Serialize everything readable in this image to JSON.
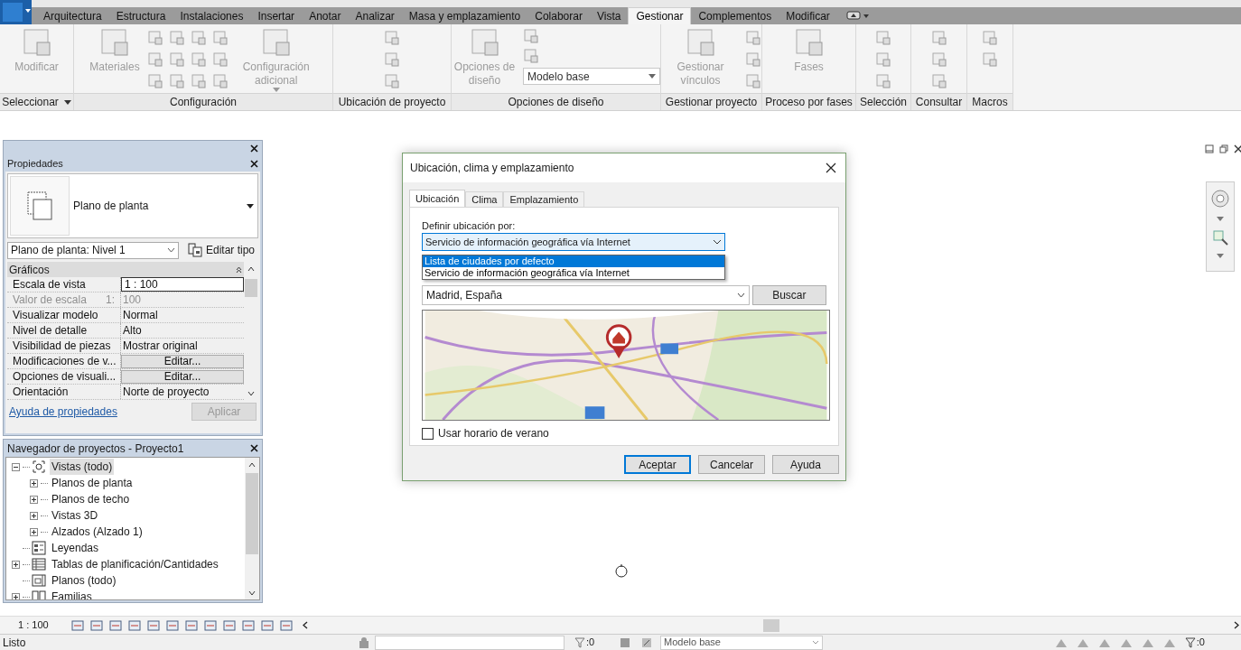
{
  "ribbon_tabs": [
    {
      "label": "Arquitectura",
      "selected": false
    },
    {
      "label": "Estructura",
      "selected": false
    },
    {
      "label": "Instalaciones",
      "selected": false
    },
    {
      "label": "Insertar",
      "selected": false
    },
    {
      "label": "Anotar",
      "selected": false
    },
    {
      "label": "Analizar",
      "selected": false
    },
    {
      "label": "Masa y emplazamiento",
      "selected": false
    },
    {
      "label": "Colaborar",
      "selected": false
    },
    {
      "label": "Vista",
      "selected": false
    },
    {
      "label": "Gestionar",
      "selected": true
    },
    {
      "label": "Complementos",
      "selected": false
    },
    {
      "label": "Modificar",
      "selected": false
    }
  ],
  "ribbon_panels": [
    {
      "title": "Seleccionar",
      "menu": true,
      "buttons": [
        {
          "label": "Modificar"
        }
      ]
    },
    {
      "title": "Configuración",
      "buttons": [
        {
          "label": "Materiales"
        },
        {
          "label": "Configuración adicional"
        }
      ]
    },
    {
      "title": "Ubicación de proyecto"
    },
    {
      "title": "Opciones de diseño",
      "buttons": [
        {
          "label": "Opciones de diseño"
        }
      ],
      "dropdown": "Modelo base"
    },
    {
      "title": "Gestionar proyecto",
      "buttons": [
        {
          "label": "Gestionar vínculos"
        }
      ]
    },
    {
      "title": "Proceso por fases",
      "buttons": [
        {
          "label": "Fases"
        }
      ]
    },
    {
      "title": "Selección"
    },
    {
      "title": "Consultar"
    },
    {
      "title": "Macros"
    }
  ],
  "properties": {
    "title": "Propiedades",
    "type_name": "Plano de planta",
    "instance": "Plano de planta: Nivel 1",
    "edit_type": "Editar tipo",
    "group": "Gráficos",
    "rows": [
      {
        "label": "Escala de vista",
        "value": "1 : 100",
        "kind": "field",
        "disabled": false
      },
      {
        "label": "Valor de escala",
        "unit": "1:",
        "value": "100",
        "kind": "text",
        "disabled": true
      },
      {
        "label": "Visualizar modelo",
        "value": "Normal",
        "kind": "text",
        "disabled": false
      },
      {
        "label": "Nivel de detalle",
        "value": "Alto",
        "kind": "text",
        "disabled": false
      },
      {
        "label": "Visibilidad de piezas",
        "value": "Mostrar original",
        "kind": "text",
        "disabled": false
      },
      {
        "label": "Modificaciones de v...",
        "value": "Editar...",
        "kind": "button",
        "disabled": false
      },
      {
        "label": "Opciones de visuali...",
        "value": "Editar...",
        "kind": "button",
        "disabled": false
      },
      {
        "label": "Orientación",
        "value": "Norte de proyecto",
        "kind": "text",
        "disabled": false
      }
    ],
    "help_link": "Ayuda de propiedades",
    "apply": "Aplicar"
  },
  "project_browser": {
    "title": "Navegador de proyectos - Proyecto1",
    "tree": [
      {
        "label": "Vistas (todo)",
        "expanded": true,
        "selected": true,
        "children": [
          {
            "label": "Planos de planta",
            "expanded": false,
            "selected": false
          },
          {
            "label": "Planos de techo",
            "expanded": false,
            "selected": false
          },
          {
            "label": "Vistas 3D",
            "expanded": false,
            "selected": false
          },
          {
            "label": "Alzados (Alzado 1)",
            "expanded": false,
            "selected": false
          }
        ]
      },
      {
        "label": "Leyendas",
        "selected": false
      },
      {
        "label": "Tablas de planificación/Cantidades",
        "expanded": false,
        "selected": false
      },
      {
        "label": "Planos (todo)",
        "selected": false
      },
      {
        "label": "Familias",
        "expanded": false,
        "selected": false
      }
    ]
  },
  "dialog": {
    "title": "Ubicación, clima y emplazamiento",
    "tabs": [
      {
        "label": "Ubicación",
        "selected": true
      },
      {
        "label": "Clima",
        "selected": false
      },
      {
        "label": "Emplazamiento",
        "selected": false
      }
    ],
    "define_label": "Definir ubicación por:",
    "define_value": "Servicio de información geográfica vía Internet",
    "options": [
      {
        "label": "Lista de ciudades por defecto",
        "selected": true
      },
      {
        "label": "Servicio de información geográfica vía Internet",
        "selected": false
      }
    ],
    "location": "Madrid, España",
    "search_button": "Buscar",
    "dst": {
      "label": "Usar horario de verano",
      "checked": false
    },
    "buttons": [
      {
        "label": "Aceptar",
        "default": true
      },
      {
        "label": "Cancelar",
        "default": false
      },
      {
        "label": "Ayuda",
        "default": false
      }
    ]
  },
  "view_bar": {
    "scale": "1 : 100"
  },
  "status_bar": {
    "text": "Listo",
    "count_left": ":0",
    "design_option": "Modelo base",
    "count_right": ":0"
  }
}
